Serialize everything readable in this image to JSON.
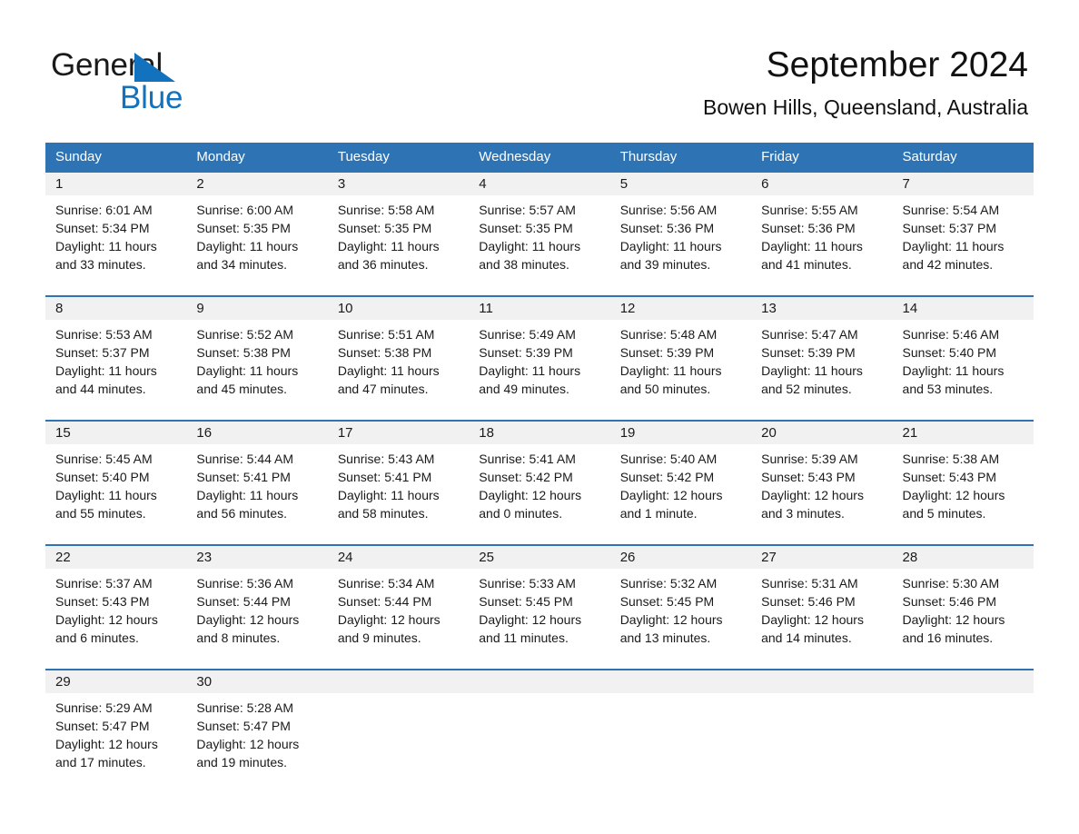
{
  "brand": {
    "name_part1": "General",
    "name_part2": "Blue",
    "triangle_color": "#1272bd",
    "blue_color": "#1272bd"
  },
  "header": {
    "title": "September 2024",
    "subtitle": "Bowen Hills, Queensland, Australia"
  },
  "theme": {
    "header_blue": "#2e74b5",
    "datebar_gray": "#f1f1f1",
    "text_color": "#1a1a1a"
  },
  "calendar": {
    "weekday_headers": [
      "Sunday",
      "Monday",
      "Tuesday",
      "Wednesday",
      "Thursday",
      "Friday",
      "Saturday"
    ],
    "weeks": [
      {
        "days": [
          {
            "date": "1",
            "sunrise": "Sunrise: 6:01 AM",
            "sunset": "Sunset: 5:34 PM",
            "daylight": "Daylight: 11 hours and 33 minutes."
          },
          {
            "date": "2",
            "sunrise": "Sunrise: 6:00 AM",
            "sunset": "Sunset: 5:35 PM",
            "daylight": "Daylight: 11 hours and 34 minutes."
          },
          {
            "date": "3",
            "sunrise": "Sunrise: 5:58 AM",
            "sunset": "Sunset: 5:35 PM",
            "daylight": "Daylight: 11 hours and 36 minutes."
          },
          {
            "date": "4",
            "sunrise": "Sunrise: 5:57 AM",
            "sunset": "Sunset: 5:35 PM",
            "daylight": "Daylight: 11 hours and 38 minutes."
          },
          {
            "date": "5",
            "sunrise": "Sunrise: 5:56 AM",
            "sunset": "Sunset: 5:36 PM",
            "daylight": "Daylight: 11 hours and 39 minutes."
          },
          {
            "date": "6",
            "sunrise": "Sunrise: 5:55 AM",
            "sunset": "Sunset: 5:36 PM",
            "daylight": "Daylight: 11 hours and 41 minutes."
          },
          {
            "date": "7",
            "sunrise": "Sunrise: 5:54 AM",
            "sunset": "Sunset: 5:37 PM",
            "daylight": "Daylight: 11 hours and 42 minutes."
          }
        ]
      },
      {
        "days": [
          {
            "date": "8",
            "sunrise": "Sunrise: 5:53 AM",
            "sunset": "Sunset: 5:37 PM",
            "daylight": "Daylight: 11 hours and 44 minutes."
          },
          {
            "date": "9",
            "sunrise": "Sunrise: 5:52 AM",
            "sunset": "Sunset: 5:38 PM",
            "daylight": "Daylight: 11 hours and 45 minutes."
          },
          {
            "date": "10",
            "sunrise": "Sunrise: 5:51 AM",
            "sunset": "Sunset: 5:38 PM",
            "daylight": "Daylight: 11 hours and 47 minutes."
          },
          {
            "date": "11",
            "sunrise": "Sunrise: 5:49 AM",
            "sunset": "Sunset: 5:39 PM",
            "daylight": "Daylight: 11 hours and 49 minutes."
          },
          {
            "date": "12",
            "sunrise": "Sunrise: 5:48 AM",
            "sunset": "Sunset: 5:39 PM",
            "daylight": "Daylight: 11 hours and 50 minutes."
          },
          {
            "date": "13",
            "sunrise": "Sunrise: 5:47 AM",
            "sunset": "Sunset: 5:39 PM",
            "daylight": "Daylight: 11 hours and 52 minutes."
          },
          {
            "date": "14",
            "sunrise": "Sunrise: 5:46 AM",
            "sunset": "Sunset: 5:40 PM",
            "daylight": "Daylight: 11 hours and 53 minutes."
          }
        ]
      },
      {
        "days": [
          {
            "date": "15",
            "sunrise": "Sunrise: 5:45 AM",
            "sunset": "Sunset: 5:40 PM",
            "daylight": "Daylight: 11 hours and 55 minutes."
          },
          {
            "date": "16",
            "sunrise": "Sunrise: 5:44 AM",
            "sunset": "Sunset: 5:41 PM",
            "daylight": "Daylight: 11 hours and 56 minutes."
          },
          {
            "date": "17",
            "sunrise": "Sunrise: 5:43 AM",
            "sunset": "Sunset: 5:41 PM",
            "daylight": "Daylight: 11 hours and 58 minutes."
          },
          {
            "date": "18",
            "sunrise": "Sunrise: 5:41 AM",
            "sunset": "Sunset: 5:42 PM",
            "daylight": "Daylight: 12 hours and 0 minutes."
          },
          {
            "date": "19",
            "sunrise": "Sunrise: 5:40 AM",
            "sunset": "Sunset: 5:42 PM",
            "daylight": "Daylight: 12 hours and 1 minute."
          },
          {
            "date": "20",
            "sunrise": "Sunrise: 5:39 AM",
            "sunset": "Sunset: 5:43 PM",
            "daylight": "Daylight: 12 hours and 3 minutes."
          },
          {
            "date": "21",
            "sunrise": "Sunrise: 5:38 AM",
            "sunset": "Sunset: 5:43 PM",
            "daylight": "Daylight: 12 hours and 5 minutes."
          }
        ]
      },
      {
        "days": [
          {
            "date": "22",
            "sunrise": "Sunrise: 5:37 AM",
            "sunset": "Sunset: 5:43 PM",
            "daylight": "Daylight: 12 hours and 6 minutes."
          },
          {
            "date": "23",
            "sunrise": "Sunrise: 5:36 AM",
            "sunset": "Sunset: 5:44 PM",
            "daylight": "Daylight: 12 hours and 8 minutes."
          },
          {
            "date": "24",
            "sunrise": "Sunrise: 5:34 AM",
            "sunset": "Sunset: 5:44 PM",
            "daylight": "Daylight: 12 hours and 9 minutes."
          },
          {
            "date": "25",
            "sunrise": "Sunrise: 5:33 AM",
            "sunset": "Sunset: 5:45 PM",
            "daylight": "Daylight: 12 hours and 11 minutes."
          },
          {
            "date": "26",
            "sunrise": "Sunrise: 5:32 AM",
            "sunset": "Sunset: 5:45 PM",
            "daylight": "Daylight: 12 hours and 13 minutes."
          },
          {
            "date": "27",
            "sunrise": "Sunrise: 5:31 AM",
            "sunset": "Sunset: 5:46 PM",
            "daylight": "Daylight: 12 hours and 14 minutes."
          },
          {
            "date": "28",
            "sunrise": "Sunrise: 5:30 AM",
            "sunset": "Sunset: 5:46 PM",
            "daylight": "Daylight: 12 hours and 16 minutes."
          }
        ]
      },
      {
        "days": [
          {
            "date": "29",
            "sunrise": "Sunrise: 5:29 AM",
            "sunset": "Sunset: 5:47 PM",
            "daylight": "Daylight: 12 hours and 17 minutes."
          },
          {
            "date": "30",
            "sunrise": "Sunrise: 5:28 AM",
            "sunset": "Sunset: 5:47 PM",
            "daylight": "Daylight: 12 hours and 19 minutes."
          },
          {
            "date": "",
            "sunrise": "",
            "sunset": "",
            "daylight": ""
          },
          {
            "date": "",
            "sunrise": "",
            "sunset": "",
            "daylight": ""
          },
          {
            "date": "",
            "sunrise": "",
            "sunset": "",
            "daylight": ""
          },
          {
            "date": "",
            "sunrise": "",
            "sunset": "",
            "daylight": ""
          },
          {
            "date": "",
            "sunrise": "",
            "sunset": "",
            "daylight": ""
          }
        ]
      }
    ]
  }
}
